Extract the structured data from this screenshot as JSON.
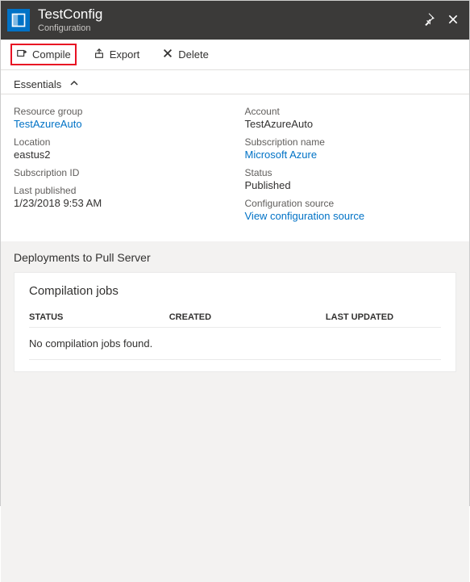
{
  "header": {
    "title": "TestConfig",
    "subtitle": "Configuration",
    "pin_label": "Pin",
    "close_label": "Close"
  },
  "toolbar": {
    "compile_label": "Compile",
    "export_label": "Export",
    "delete_label": "Delete"
  },
  "essentials": {
    "toggle_label": "Essentials",
    "left": {
      "resource_group_label": "Resource group",
      "resource_group_value": "TestAzureAuto",
      "location_label": "Location",
      "location_value": "eastus2",
      "subscription_id_label": "Subscription ID",
      "subscription_id_value": "",
      "last_published_label": "Last published",
      "last_published_value": "1/23/2018 9:53 AM"
    },
    "right": {
      "account_label": "Account",
      "account_value": "TestAzureAuto",
      "subscription_name_label": "Subscription name",
      "subscription_name_value": "Microsoft Azure",
      "status_label": "Status",
      "status_value": "Published",
      "config_source_label": "Configuration source",
      "config_source_value": "View configuration source"
    }
  },
  "section": {
    "title": "Deployments to Pull Server",
    "panel_title": "Compilation jobs",
    "columns": {
      "status": "STATUS",
      "created": "CREATED",
      "updated": "LAST UPDATED"
    },
    "empty_message": "No compilation jobs found."
  }
}
